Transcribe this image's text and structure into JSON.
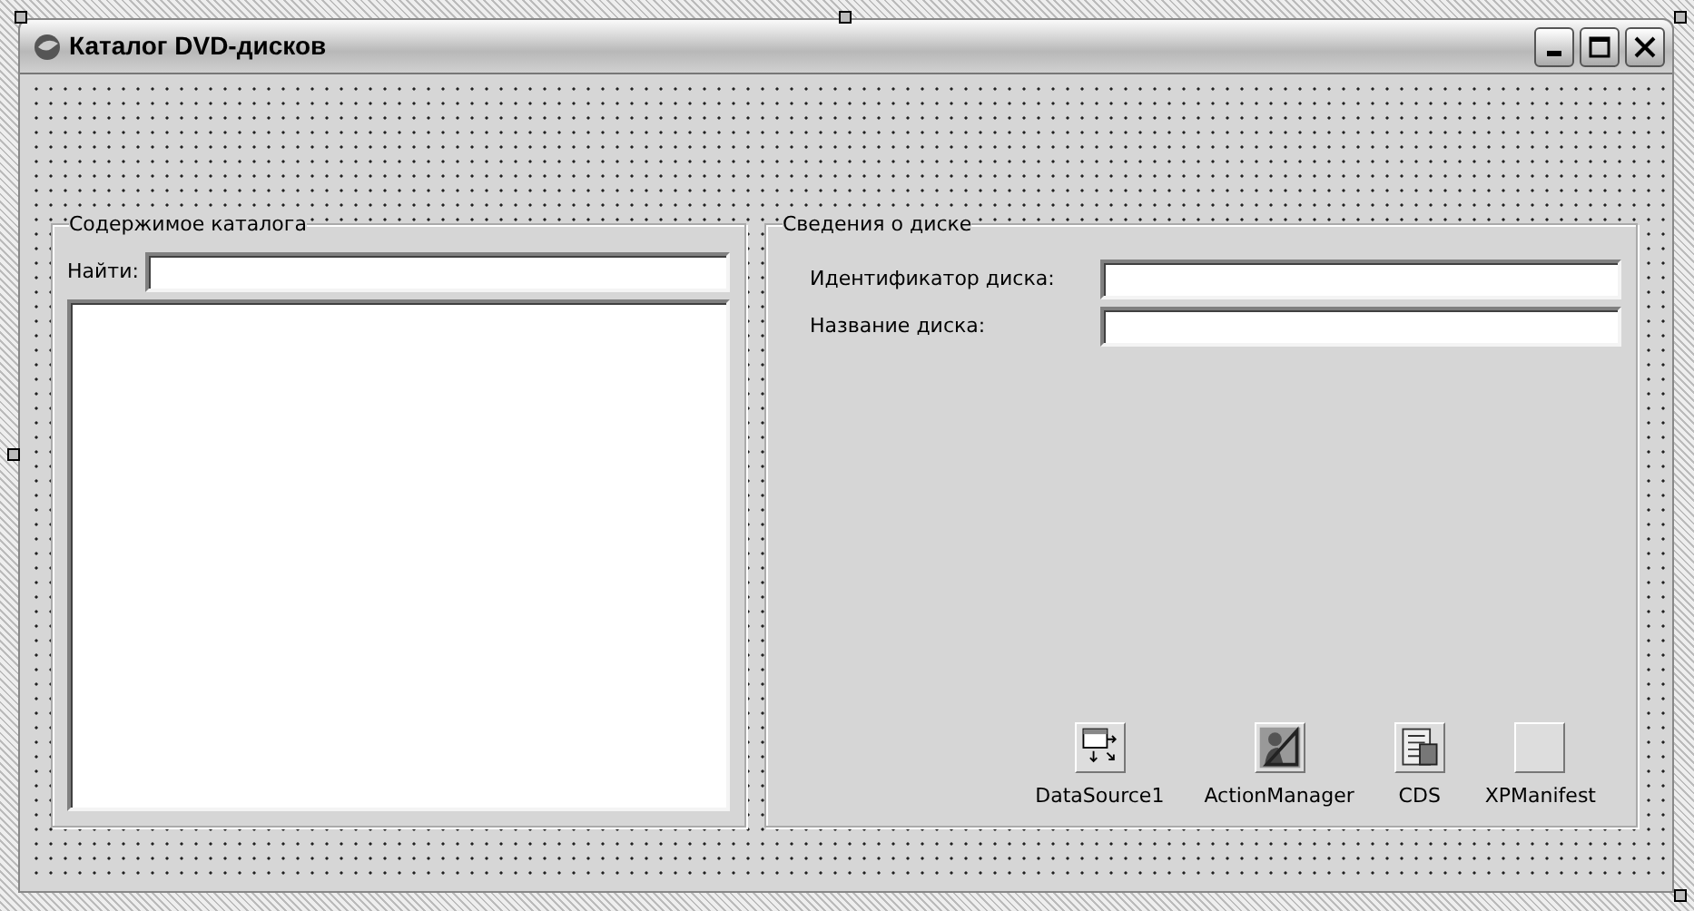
{
  "window": {
    "title": "Каталог DVD-дисков"
  },
  "catalog_group": {
    "caption": "Содержимое каталога",
    "search_label": "Найти:"
  },
  "disc_group": {
    "caption": "Сведения о диске",
    "fields": [
      {
        "label": "Идентификатор диска:"
      },
      {
        "label": "Название диска:"
      }
    ]
  },
  "components": [
    {
      "name": "DataSource1",
      "kind": "datasource"
    },
    {
      "name": "ActionManager",
      "kind": "actionmanager"
    },
    {
      "name": "CDS",
      "kind": "dataset"
    },
    {
      "name": "XPManifest",
      "kind": "blank"
    }
  ]
}
